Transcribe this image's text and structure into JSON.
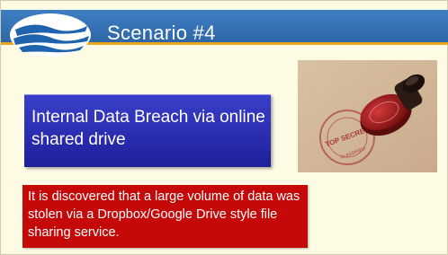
{
  "slide": {
    "title": "Scenario #4",
    "heading": "Internal Data Breach via online shared drive",
    "description": "It is discovered that a large volume of data was stolen via a Dropbox/Google Drive style file sharing service.",
    "stamp_text_top": "TOP SECRET",
    "stamp_text_bottom": "CLASSIFIED"
  },
  "icons": {
    "logo": "wave-logo-icon",
    "photo": "top-secret-stamp-image"
  },
  "colors": {
    "header": "#3673b5",
    "header_underline": "#e6a61d",
    "background": "#fdfbe4",
    "heading_box": "#2a2db3",
    "description_box": "#c50808",
    "text": "#ffffff"
  }
}
